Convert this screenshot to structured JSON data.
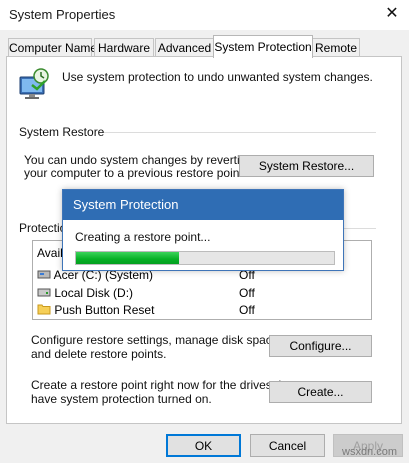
{
  "window": {
    "title": "System Properties",
    "close_glyph": "✕"
  },
  "tabs": [
    {
      "label": "Computer Name",
      "active": false
    },
    {
      "label": "Hardware",
      "active": false
    },
    {
      "label": "Advanced",
      "active": false
    },
    {
      "label": "System Protection",
      "active": true
    },
    {
      "label": "Remote",
      "active": false
    }
  ],
  "intro_text": "Use system protection to undo unwanted system changes.",
  "system_restore": {
    "heading": "System Restore",
    "description_line1": "You can undo system changes by reverting",
    "description_line2": "your computer to a previous restore point.",
    "button_label": "System Restore..."
  },
  "protection_settings": {
    "heading_visible": "Protection",
    "column_header_visible": "Availa",
    "drives": [
      {
        "name": "Acer (C:) (System)",
        "protection": "Off",
        "icon": "system-drive-icon"
      },
      {
        "name": "Local Disk (D:)",
        "protection": "Off",
        "icon": "disk-drive-icon"
      },
      {
        "name": "Push Button Reset",
        "protection": "Off",
        "icon": "folder-icon"
      }
    ]
  },
  "configure": {
    "line1": "Configure restore settings, manage disk space,",
    "line2": "and delete restore points.",
    "button_label": "Configure..."
  },
  "create": {
    "line1": "Create a restore point right now for the drives that",
    "line2": "have system protection turned on.",
    "button_label": "Create..."
  },
  "footer": {
    "ok_label": "OK",
    "cancel_label": "Cancel",
    "apply_label": "Apply"
  },
  "dialog": {
    "title": "System Protection",
    "message": "Creating a restore point...",
    "progress_fraction": 0.4
  },
  "watermark": "wsxdn.com",
  "colors": {
    "dialog_title_bg": "#2f6db4",
    "progress_green": "#06b025",
    "default_button_border": "#0078d7"
  }
}
